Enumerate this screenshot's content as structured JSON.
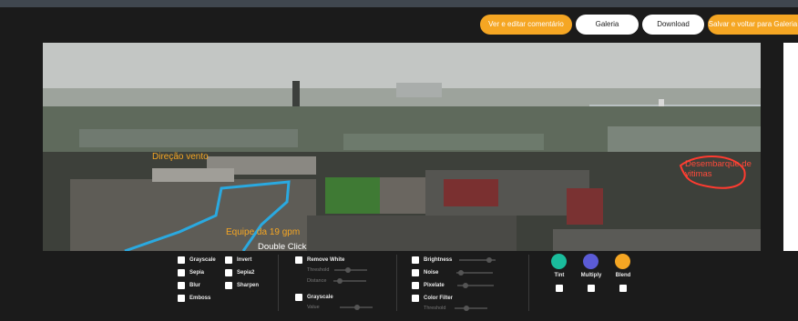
{
  "toolbar": {
    "comment_label": "Ver e editar comentário",
    "gallery_label": "Galeria",
    "download_label": "Download",
    "save_label": "Salvar e voltar para Galeria"
  },
  "annotations": {
    "wind": "Direção vento",
    "landing": "Desembarque de vitimas",
    "team": "Equipe da 19 gpm",
    "hint": "Double Click"
  },
  "filters": {
    "grayscale": "Grayscale",
    "sepia": "Sepia",
    "blur": "Blur",
    "emboss": "Emboss",
    "invert": "Invert",
    "sepia2": "Sepia2",
    "sharpen": "Sharpen",
    "remove_white": "Remove White",
    "threshold": "Threshold",
    "distance": "Distance",
    "grayscale2": "Grayscale",
    "value": "Value",
    "brightness": "Brightness",
    "noise": "Noise",
    "pixelate": "Pixelate",
    "color_filter": "Color Filter",
    "threshold2": "Threshold"
  },
  "blend": {
    "tint": "Tint",
    "multiply": "Multiply",
    "blend": "Blend",
    "tint_color": "#1abc9c",
    "multiply_color": "#5b5bd6",
    "blend_color": "#f5a623"
  },
  "colors": {
    "accent": "#f5a623",
    "annotation_blue": "#2aa9e0",
    "annotation_red": "#ff3b30"
  }
}
